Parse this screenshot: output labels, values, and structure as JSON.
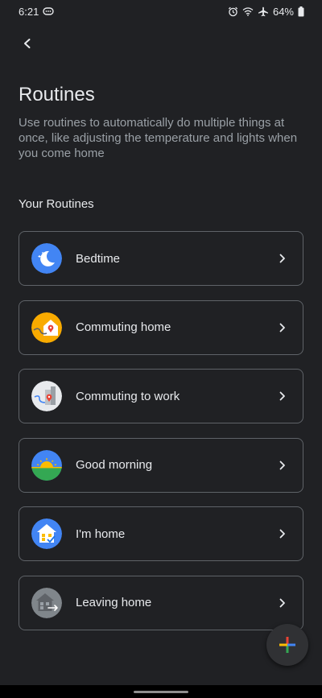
{
  "status_bar": {
    "time": "6:21",
    "battery_percent": "64%",
    "icons": [
      "message-icon",
      "alarm-icon",
      "wifi-icon",
      "airplane-icon",
      "battery-icon"
    ]
  },
  "header": {
    "title": "Routines",
    "description": "Use routines to automatically do multiple things at once, like adjusting the temperature and lights when you come home"
  },
  "section": {
    "heading": "Your Routines"
  },
  "routines": [
    {
      "label": "Bedtime",
      "icon": "bedtime-moon-icon"
    },
    {
      "label": "Commuting home",
      "icon": "commuting-home-icon"
    },
    {
      "label": "Commuting to work",
      "icon": "commuting-work-icon"
    },
    {
      "label": "Good morning",
      "icon": "sunrise-icon"
    },
    {
      "label": "I'm home",
      "icon": "home-arrive-icon"
    },
    {
      "label": "Leaving home",
      "icon": "home-leave-icon"
    }
  ],
  "colors": {
    "background": "#202124",
    "card_border": "#5f6368",
    "text_primary": "#e8eaed",
    "text_secondary": "#9aa0a6",
    "fab_background": "#303134"
  }
}
